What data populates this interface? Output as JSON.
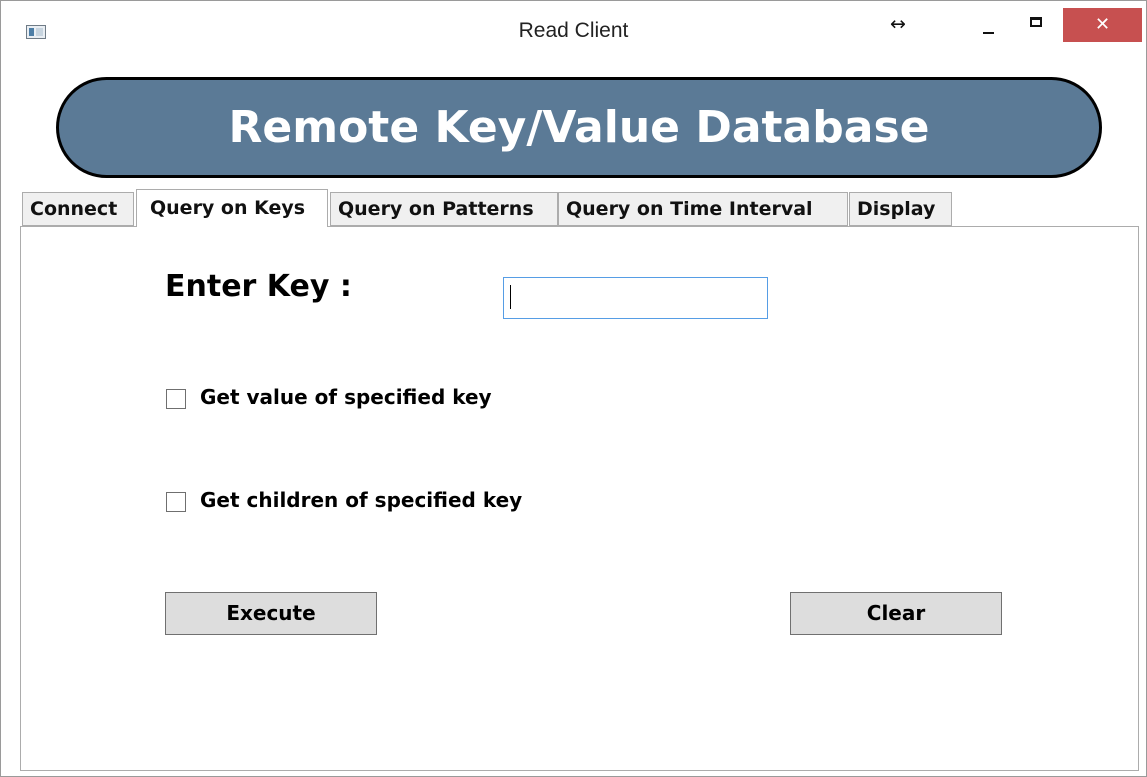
{
  "window": {
    "title": "Read Client",
    "resize_glyph": "↔",
    "close_glyph": "✕",
    "icons": [
      "app-icon",
      "resize-icon",
      "minimize-icon",
      "maximize-icon",
      "close-icon"
    ],
    "close_color": "#c75050"
  },
  "header": {
    "title": "Remote Key/Value Database",
    "background_color": "#5b7a96"
  },
  "tabs": [
    {
      "label": "Connect",
      "selected": false
    },
    {
      "label": "Query on Keys",
      "selected": true
    },
    {
      "label": "Query on Patterns",
      "selected": false
    },
    {
      "label": "Query on Time Interval",
      "selected": false
    },
    {
      "label": "Display",
      "selected": false
    }
  ],
  "form": {
    "enter_key_label": "Enter Key :",
    "key_input_value": "",
    "checkboxes": [
      {
        "label": "Get value of specified key",
        "checked": false
      },
      {
        "label": "Get children of specified key",
        "checked": false
      }
    ]
  },
  "buttons": {
    "execute_label": "Execute",
    "clear_label": "Clear"
  }
}
